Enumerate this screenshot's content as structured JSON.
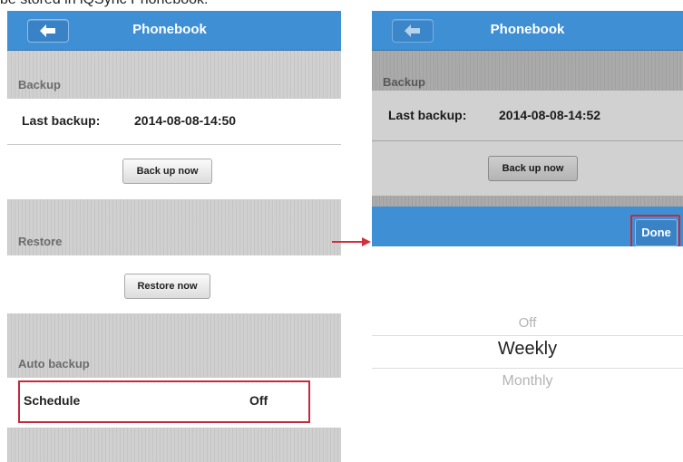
{
  "caption": "be stored in iQSync Phonebook:",
  "left": {
    "title": "Phonebook",
    "backup_header": "Backup",
    "last_backup_label": "Last backup:",
    "last_backup_value": "2014-08-08-14:50",
    "backup_button": "Back up now",
    "restore_header": "Restore",
    "restore_button": "Restore now",
    "auto_backup_header": "Auto backup",
    "schedule_label": "Schedule",
    "schedule_value": "Off"
  },
  "right": {
    "title": "Phonebook",
    "backup_header": "Backup",
    "last_backup_label": "Last backup:",
    "last_backup_value": "2014-08-08-14:52",
    "backup_button": "Back up now",
    "done_button": "Done",
    "options": [
      "Off",
      "Weekly",
      "Monthly"
    ],
    "selected_option": "Weekly"
  },
  "colors": {
    "header_blue": "#3e8fd4",
    "highlight_red": "#c4293c",
    "section_gray": "#d0d0d0"
  },
  "icons": {
    "back": "back-arrow-icon",
    "connector": "red-arrow-icon"
  }
}
